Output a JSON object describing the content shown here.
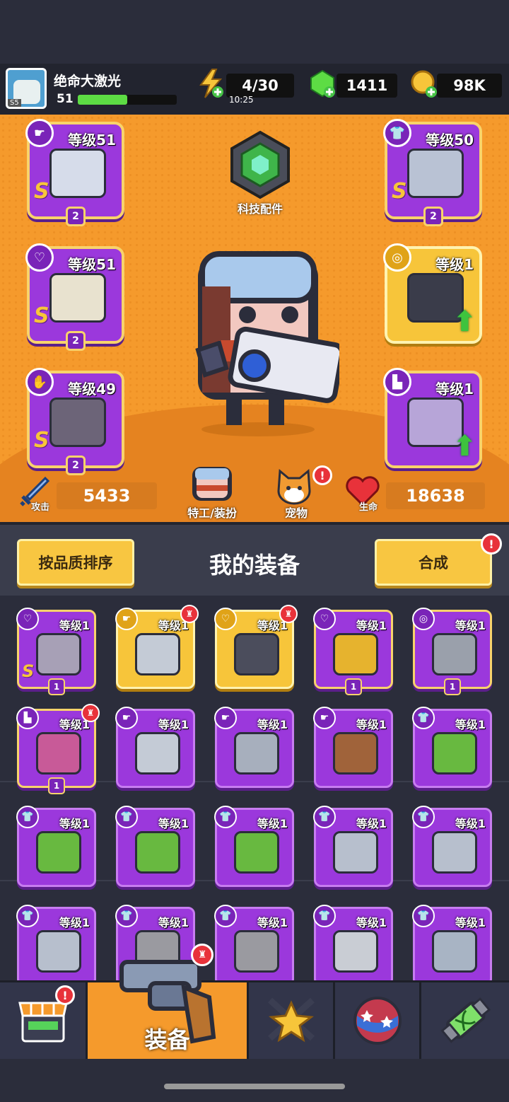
{
  "player": {
    "name": "绝命大激光",
    "level": "51",
    "avatar_badge": "S5",
    "xp_fraction": 0.5
  },
  "resources": {
    "energy": "4/30",
    "energy_timer": "10:25",
    "gems": "1411",
    "coins": "98K"
  },
  "tech": {
    "label": "科技配件"
  },
  "equipped": [
    {
      "slot": "weapon",
      "level": "等级51",
      "grade": "S",
      "stars": "2",
      "icon": "gun-icon",
      "rarity": "purple"
    },
    {
      "slot": "armor",
      "level": "等级50",
      "grade": "S",
      "stars": "2",
      "icon": "chest-armor-icon",
      "rarity": "purple"
    },
    {
      "slot": "necklace",
      "level": "等级51",
      "grade": "S",
      "stars": "2",
      "icon": "ring-star-icon",
      "rarity": "purple"
    },
    {
      "slot": "belt",
      "level": "等级1",
      "grade": "",
      "stars": "",
      "icon": "belt-icon",
      "rarity": "gold",
      "upgrade": true
    },
    {
      "slot": "gloves",
      "level": "等级49",
      "grade": "S",
      "stars": "2",
      "icon": "gauntlet-icon",
      "rarity": "purple"
    },
    {
      "slot": "boots",
      "level": "等级1",
      "grade": "",
      "stars": "",
      "icon": "boot-icon",
      "rarity": "purple",
      "upgrade": true
    }
  ],
  "stats": {
    "attack_label": "攻击",
    "attack": "5433",
    "hp_label": "生命",
    "hp": "18638"
  },
  "middle_buttons": {
    "agent": "特工/装扮",
    "pet": "宠物",
    "pet_notice": "!"
  },
  "section": {
    "sort_button": "按品质排序",
    "title": "我的装备",
    "merge_button": "合成",
    "merge_notice": "!"
  },
  "inventory": [
    {
      "level": "等级1",
      "grade": "S",
      "stars": "1",
      "icon": "chain-necklace-icon",
      "rarity": "purple",
      "color": "#a7a0b6"
    },
    {
      "level": "等级1",
      "grade": "",
      "stars": "",
      "icon": "kunai-icon",
      "rarity": "gold",
      "color": "#c4cbd6",
      "new": true
    },
    {
      "level": "等级1",
      "grade": "",
      "stars": "",
      "icon": "spiked-collar-icon",
      "rarity": "gold",
      "color": "#4b4d5c",
      "new": true
    },
    {
      "level": "等级1",
      "grade": "",
      "stars": "1",
      "icon": "lantern-necklace-icon",
      "rarity": "purple",
      "color": "#e6b32e"
    },
    {
      "level": "等级1",
      "grade": "",
      "stars": "1",
      "icon": "belt-gem-icon",
      "rarity": "purple",
      "color": "#9aa0ab"
    },
    {
      "level": "等级1",
      "grade": "",
      "stars": "1",
      "icon": "claw-boot-icon",
      "rarity": "purple",
      "color": "#c85a98",
      "new": true
    },
    {
      "level": "等级1",
      "grade": "",
      "stars": "",
      "icon": "kunai-icon",
      "rarity": "purple",
      "color": "#c4cbd6"
    },
    {
      "level": "等级1",
      "grade": "",
      "stars": "",
      "icon": "revolver-icon",
      "rarity": "purple",
      "color": "#a7afbd"
    },
    {
      "level": "等级1",
      "grade": "",
      "stars": "",
      "icon": "shotgun-icon",
      "rarity": "purple",
      "color": "#a0633a"
    },
    {
      "level": "等级1",
      "grade": "",
      "stars": "",
      "icon": "leaf-armor-icon",
      "rarity": "purple",
      "color": "#68b940"
    },
    {
      "level": "等级1",
      "grade": "",
      "stars": "",
      "icon": "leaf-armor-icon",
      "rarity": "purple",
      "color": "#68b940"
    },
    {
      "level": "等级1",
      "grade": "",
      "stars": "",
      "icon": "leaf-armor-icon",
      "rarity": "purple",
      "color": "#68b940"
    },
    {
      "level": "等级1",
      "grade": "",
      "stars": "",
      "icon": "leaf-armor-icon",
      "rarity": "purple",
      "color": "#68b940"
    },
    {
      "level": "等级1",
      "grade": "",
      "stars": "",
      "icon": "steel-armor-icon",
      "rarity": "purple",
      "color": "#b7bfcd"
    },
    {
      "level": "等级1",
      "grade": "",
      "stars": "",
      "icon": "steel-armor-icon",
      "rarity": "purple",
      "color": "#b7bfcd"
    },
    {
      "level": "等级1",
      "grade": "",
      "stars": "",
      "icon": "steel-armor-icon",
      "rarity": "purple",
      "color": "#b7bfcd"
    },
    {
      "level": "等级1",
      "grade": "",
      "stars": "",
      "icon": "stone-armor-icon",
      "rarity": "purple",
      "color": "#9a9aa0"
    },
    {
      "level": "等级1",
      "grade": "",
      "stars": "",
      "icon": "stone-armor-icon",
      "rarity": "purple",
      "color": "#9a9aa0"
    },
    {
      "level": "等级1",
      "grade": "",
      "stars": "",
      "icon": "vest-armor-icon",
      "rarity": "purple",
      "color": "#c9cdd4"
    },
    {
      "level": "等级1",
      "grade": "",
      "stars": "",
      "icon": "tech-armor-icon",
      "rarity": "purple",
      "color": "#a8b4c4"
    }
  ],
  "nav": [
    {
      "id": "shop",
      "icon": "shop-icon",
      "label": "",
      "notice": "!"
    },
    {
      "id": "equipment",
      "icon": "revolver-icon",
      "label": "装备",
      "active": true,
      "notice": ""
    },
    {
      "id": "battle",
      "icon": "crossed-swords-star-icon",
      "label": ""
    },
    {
      "id": "events",
      "icon": "star-ball-icon",
      "label": ""
    },
    {
      "id": "lab",
      "icon": "dna-capsule-icon",
      "label": ""
    }
  ],
  "colors": {
    "stage_bg": "#f59a2c",
    "rare_purple": "#9b38dc",
    "gold": "#f7c53a",
    "notice_red": "#e8323a"
  }
}
